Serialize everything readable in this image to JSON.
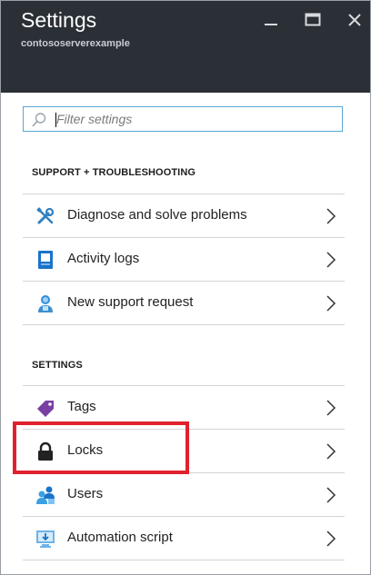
{
  "window": {
    "title": "Settings",
    "subtitle": "contososerverexample",
    "controls": [
      "minimize-icon",
      "maximize-icon",
      "close-icon"
    ],
    "header_color": "#2b2f36"
  },
  "search": {
    "placeholder": "Filter settings",
    "value": ""
  },
  "sections": [
    {
      "heading": "SUPPORT + TROUBLESHOOTING",
      "items": [
        {
          "label": "Diagnose and solve problems",
          "icon": "wrench-screwdriver-icon"
        },
        {
          "label": "Activity logs",
          "icon": "log-book-icon"
        },
        {
          "label": "New support request",
          "icon": "support-person-icon"
        }
      ]
    },
    {
      "heading": "SETTINGS",
      "items": [
        {
          "label": "Tags",
          "icon": "tag-icon"
        },
        {
          "label": "Locks",
          "icon": "lock-icon",
          "highlighted": true
        },
        {
          "label": "Users",
          "icon": "users-icon"
        },
        {
          "label": "Automation script",
          "icon": "script-download-icon"
        }
      ]
    }
  ],
  "highlight_color": "#e0212e",
  "accent": "#57a8d8"
}
